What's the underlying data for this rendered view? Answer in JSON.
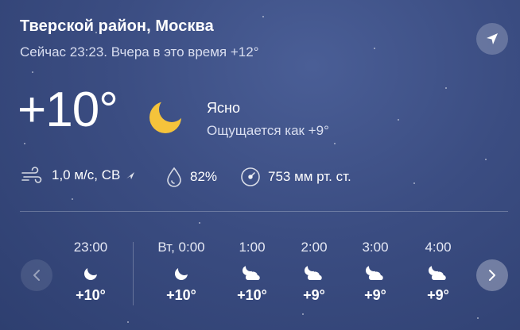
{
  "location": "Тверской район, Москва",
  "subtitle": "Сейчас 23:23. Вчера в это время +12°",
  "current": {
    "temp": "+10°",
    "condition": "Ясно",
    "feels_like": "Ощущается как +9°",
    "icon": "moon-icon"
  },
  "details": {
    "wind": "1,0 м/с, СВ",
    "humidity": "82%",
    "pressure": "753 мм рт. ст."
  },
  "hourly": [
    {
      "time": "23:00",
      "temp": "+10°",
      "icon": "moon-icon"
    },
    {
      "time": "Вт, 0:00",
      "temp": "+10°",
      "icon": "moon-icon"
    },
    {
      "time": "1:00",
      "temp": "+10°",
      "icon": "moon-cloud-icon"
    },
    {
      "time": "2:00",
      "temp": "+9°",
      "icon": "moon-cloud-icon"
    },
    {
      "time": "3:00",
      "temp": "+9°",
      "icon": "moon-cloud-icon"
    },
    {
      "time": "4:00",
      "temp": "+9°",
      "icon": "moon-cloud-icon"
    }
  ],
  "colors": {
    "background": "#3b4d82",
    "moon": "#f5c33b",
    "text": "#ffffff"
  }
}
